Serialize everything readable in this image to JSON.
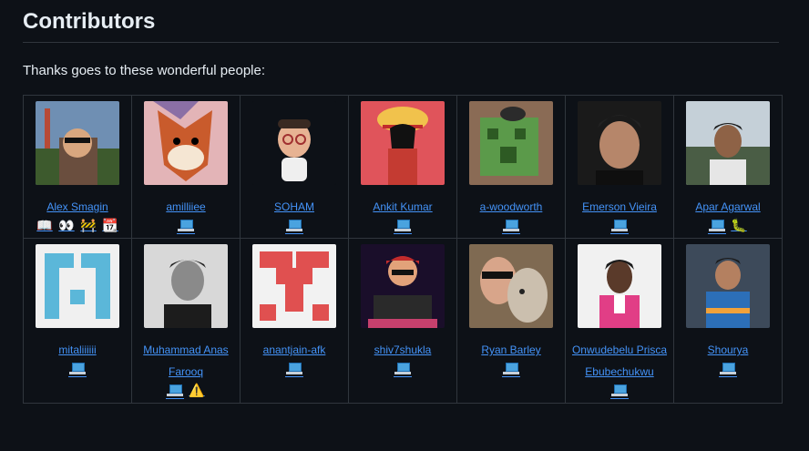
{
  "section": {
    "title": "Contributors",
    "intro": "Thanks goes to these wonderful people:"
  },
  "rows": [
    [
      {
        "name": "Alex Smagin",
        "badges": [
          "book-icon",
          "reader-icon",
          "construction-icon",
          "calendar-icon"
        ]
      },
      {
        "name": "amilliiee",
        "badges": [
          "laptop-icon"
        ]
      },
      {
        "name": "SOHAM",
        "badges": [
          "laptop-icon"
        ]
      },
      {
        "name": "Ankit Kumar",
        "badges": [
          "laptop-icon"
        ]
      },
      {
        "name": "a-woodworth",
        "badges": [
          "laptop-icon"
        ]
      },
      {
        "name": "Emerson Vieira",
        "badges": [
          "laptop-icon"
        ]
      },
      {
        "name": "Apar Agarwal",
        "badges": [
          "laptop-icon",
          "bug-icon"
        ]
      }
    ],
    [
      {
        "name": "mitaliiiiii",
        "badges": [
          "laptop-icon"
        ]
      },
      {
        "name": "Muhammad Anas Farooq",
        "badges": [
          "laptop-icon",
          "warning-icon"
        ]
      },
      {
        "name": "anantjain-afk",
        "badges": [
          "laptop-icon"
        ]
      },
      {
        "name": "shiv7shukla",
        "badges": [
          "laptop-icon"
        ]
      },
      {
        "name": "Ryan Barley",
        "badges": [
          "laptop-icon"
        ]
      },
      {
        "name": "Onwudebelu Prisca Ebubechukwu",
        "badges": [
          "laptop-icon"
        ]
      },
      {
        "name": "Shourya",
        "badges": [
          "laptop-icon"
        ]
      }
    ]
  ]
}
